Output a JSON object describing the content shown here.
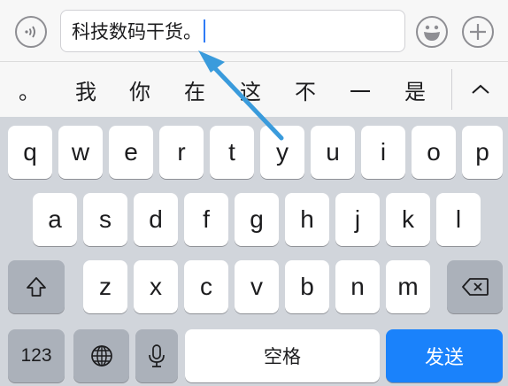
{
  "input": {
    "text": "科技数码干货。"
  },
  "candidates": [
    "。",
    "我",
    "你",
    "在",
    "这",
    "不",
    "一",
    "是"
  ],
  "keyboard": {
    "row1": [
      "q",
      "w",
      "e",
      "r",
      "t",
      "y",
      "u",
      "i",
      "o",
      "p"
    ],
    "row2": [
      "a",
      "s",
      "d",
      "f",
      "g",
      "h",
      "j",
      "k",
      "l"
    ],
    "row3": [
      "z",
      "x",
      "c",
      "v",
      "b",
      "n",
      "m"
    ],
    "numbers_label": "123",
    "space_label": "空格",
    "send_label": "发送"
  },
  "colors": {
    "accent": "#1a82fb",
    "caret": "#2f7bf6",
    "annotation_arrow": "#3a9bdc"
  },
  "icons": [
    "voice-icon",
    "emoji-icon",
    "plus-icon",
    "chevron-up-icon",
    "shift-icon",
    "delete-icon",
    "globe-icon",
    "microphone-icon"
  ]
}
